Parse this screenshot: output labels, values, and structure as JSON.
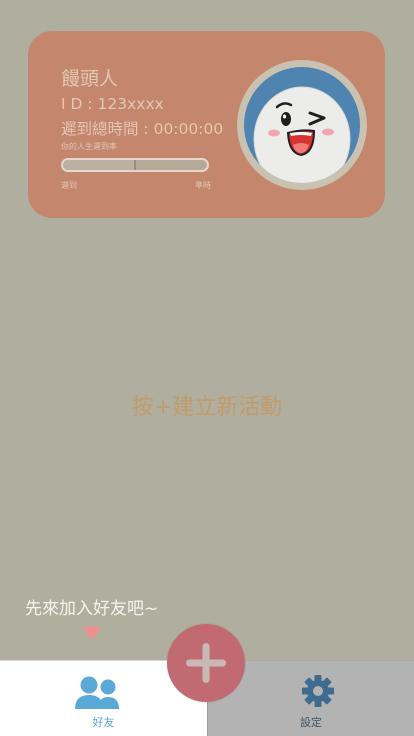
{
  "profile": {
    "name": "饅頭人",
    "id_text": "I D : 123xxxx",
    "late_total_text": "遲到總時間 : 00:00:00",
    "rate_label": "你的人生遲到率",
    "late_rate_fraction": 0.5,
    "scale_left": "遲到",
    "scale_right": "準時"
  },
  "main": {
    "empty_hint": "按+建立新活動"
  },
  "onboarding": {
    "friends_hint": "先來加入好友吧~"
  },
  "tabs": [
    {
      "label": "好友",
      "icon": "friends-icon",
      "active": true
    },
    {
      "label": "設定",
      "icon": "gear-icon",
      "active": false
    }
  ],
  "fab": {
    "icon": "plus-icon"
  },
  "colors": {
    "background": "#b0ae9e",
    "card": "#c4866c",
    "accent_fab": "#c26a72",
    "hint_text": "#c19b6b",
    "tab_active": "#5aa9d6",
    "tab_inactive_icon": "#3d6c8f"
  }
}
